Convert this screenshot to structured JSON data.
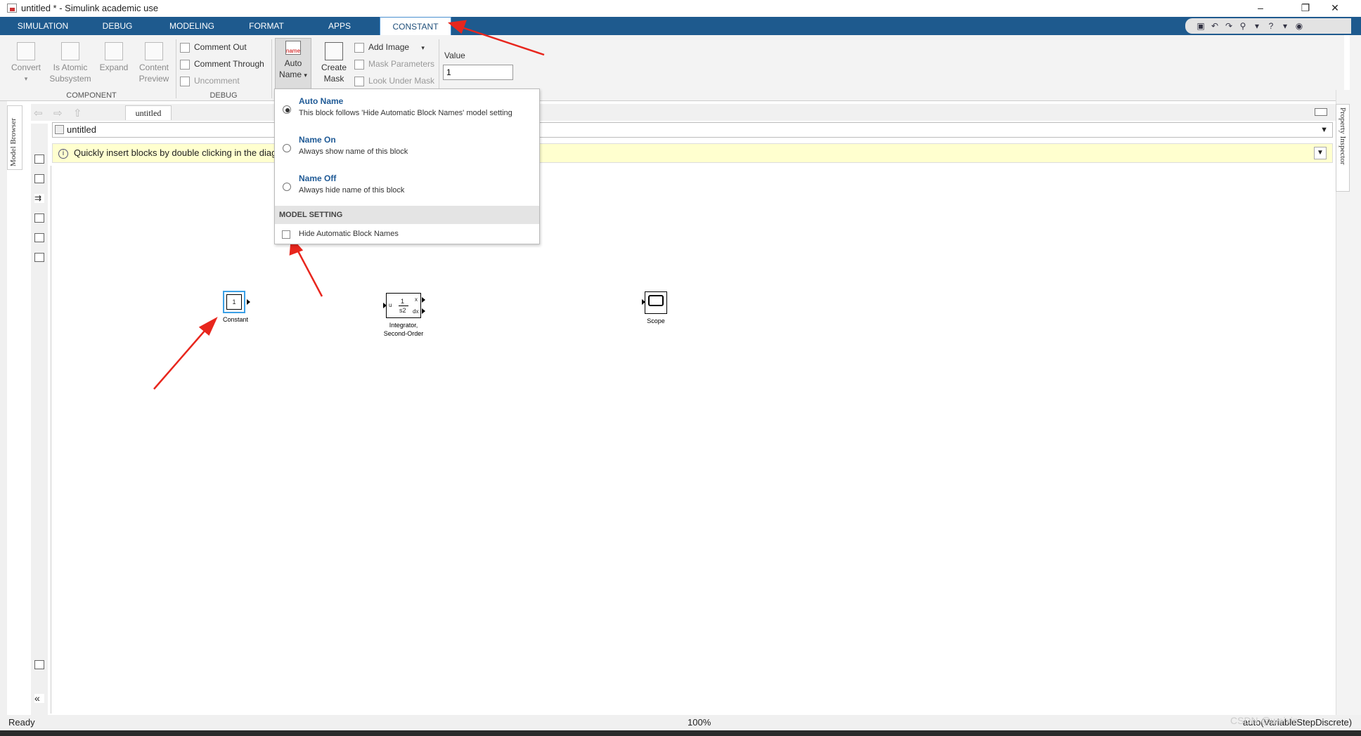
{
  "window": {
    "title": "untitled * - Simulink academic use",
    "min": "–",
    "restore": "❐",
    "close": "✕"
  },
  "tabs": [
    {
      "label": "SIMULATION"
    },
    {
      "label": "DEBUG"
    },
    {
      "label": "MODELING"
    },
    {
      "label": "FORMAT"
    },
    {
      "label": "APPS"
    },
    {
      "label": "CONSTANT"
    }
  ],
  "quick_access": [
    "▣",
    "↶",
    "↷",
    "⚲",
    "▾",
    "?",
    "▾",
    "◉"
  ],
  "ribbon": {
    "component": {
      "convert": "Convert",
      "is_atomic_1": "Is Atomic",
      "is_atomic_2": "Subsystem",
      "expand": "Expand",
      "content_1": "Content",
      "content_2": "Preview",
      "group_label": "COMPONENT"
    },
    "debug": {
      "comment_out": "Comment Out",
      "comment_through": "Comment Through",
      "uncomment": "Uncomment",
      "group_label": "DEBUG"
    },
    "auto_name": {
      "icon_text": "name",
      "line1": "Auto",
      "line2": "Name"
    },
    "create_mask": {
      "line1": "Create",
      "line2": "Mask"
    },
    "mask": {
      "add_image": "Add Image",
      "mask_params": "Mask Parameters",
      "look_under": "Look Under Mask"
    },
    "value": {
      "label": "Value",
      "input": "1"
    }
  },
  "editor": {
    "breadcrumb_tab": "untitled",
    "address": "untitled",
    "hint": "Quickly insert blocks by double clicking in the diag",
    "model_browser": "Model Browser",
    "property_inspector": "Property Inspector"
  },
  "menu": {
    "options": [
      {
        "title": "Auto Name",
        "desc": "This block follows 'Hide Automatic Block Names' model setting",
        "selected": true
      },
      {
        "title": "Name On",
        "desc": "Always show name of this block",
        "selected": false
      },
      {
        "title": "Name Off",
        "desc": "Always hide name of this block",
        "selected": false
      }
    ],
    "section": "MODEL SETTING",
    "checkbox_label": "Hide Automatic Block Names",
    "checked": false
  },
  "blocks": {
    "constant": {
      "value": "1",
      "label": "Constant"
    },
    "integrator": {
      "in": "u",
      "num": "1",
      "den": "s2",
      "out_x": "x",
      "out_dx": "dx",
      "label1": "Integrator,",
      "label2": "Second-Order"
    },
    "scope": {
      "label": "Scope"
    }
  },
  "status": {
    "ready": "Ready",
    "zoom": "100%",
    "solver": "auto(VariableStepDiscrete)",
    "watermark": "CSDN @weixin"
  },
  "annotation_color": "#e8261d"
}
